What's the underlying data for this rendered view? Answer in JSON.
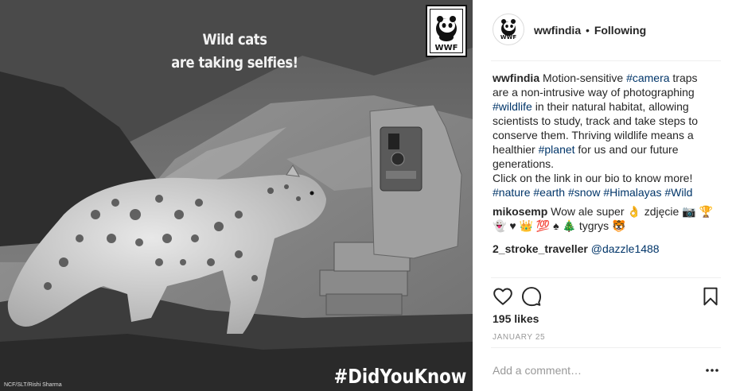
{
  "post": {
    "overlay_line1": "Wild cats",
    "overlay_line2": "are taking selfies!",
    "hashtag_overlay": "#DidYouKnow",
    "photo_credit": "NCF/SLT/Rishi Sharma",
    "logo_text": "WWF"
  },
  "header": {
    "username": "wwfindia",
    "separator": "•",
    "follow_status": "Following",
    "avatar_text": "WWF"
  },
  "caption": {
    "username": "wwfindia",
    "t1": " Motion-sensitive ",
    "h1": "#camera",
    "t2": " traps are a non-intrusive way of photographing ",
    "h2": "#wildlife",
    "t3": " in their natural habitat, allowing scientists to study, track and take steps to conserve them. Thriving wildlife means a healthier ",
    "h3": "#planet",
    "t4": " for us and our future generations.",
    "t5": "Click on the link in our bio to know more!",
    "h4": "#nature",
    "h5": "#earth",
    "h6": "#snow",
    "h7": "#Himalayas",
    "h8": "#Wild"
  },
  "comments": [
    {
      "username": "mikosemp",
      "text": " Wow ale super 👌 zdjęcie 📷 🏆 👻 ♥ 👑 💯 ♠ 🎄 tygrys 🐯"
    },
    {
      "username": "2_stroke_traveller",
      "mention": "@dazzle1488"
    }
  ],
  "icons": {
    "like": "heart-icon",
    "comment": "comment-bubble-icon",
    "save": "bookmark-icon",
    "more": "ellipsis-icon"
  },
  "likes_text": "195 likes",
  "date_text": "JANUARY 25",
  "add_comment_placeholder": "Add a comment…"
}
